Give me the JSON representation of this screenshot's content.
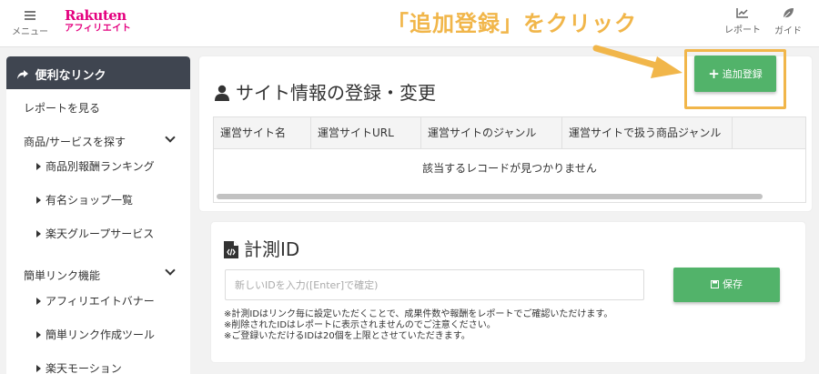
{
  "header": {
    "menu_label": "メニュー",
    "logo_line1": "Rakuten",
    "logo_line2": "アフィリエイト",
    "report_label": "レポート",
    "guide_label": "ガイド",
    "annotation": "「追加登録」をクリック"
  },
  "sidebar": {
    "heading": "便利なリンク",
    "items": [
      {
        "label": "レポートを見る"
      },
      {
        "label": "商品/サービスを探す"
      },
      {
        "label": "商品別報酬ランキング"
      },
      {
        "label": "有名ショップ一覧"
      },
      {
        "label": "楽天グループサービス"
      },
      {
        "label": "簡単リンク機能"
      },
      {
        "label": "アフィリエイトバナー"
      },
      {
        "label": "簡単リンク作成ツール"
      },
      {
        "label": "楽天モーション"
      }
    ]
  },
  "site_panel": {
    "title": "サイト情報の登録・変更",
    "add_button": "追加登録",
    "columns": [
      "運営サイト名",
      "運営サイトURL",
      "運営サイトのジャンル",
      "運営サイトで扱う商品ジャンル"
    ],
    "empty_message": "該当するレコードが見つかりません"
  },
  "measure_panel": {
    "title": "計測ID",
    "input_placeholder": "新しいIDを入力([Enter]で確定)",
    "save_button": "保存",
    "notes": [
      "※計測IDはリンク毎に設定いただくことで、成果件数や報酬をレポートでご確認いただけます。",
      "※削除されたIDはレポートに表示されませんのでご注意ください。",
      "※ご登録いただけるIDは20個を上限とさせていただきます。"
    ]
  },
  "colors": {
    "brand": "#e4007f",
    "accent_green": "#52b36a",
    "annotation_orange": "#f1b64a",
    "sidebar_header": "#3f4550"
  }
}
